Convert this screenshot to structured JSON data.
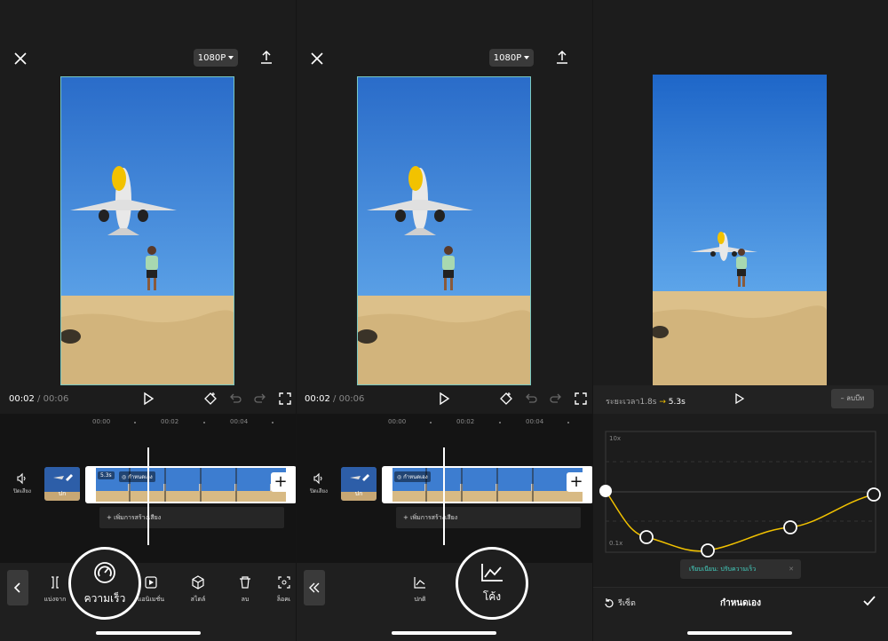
{
  "resolution": "1080P",
  "playback": {
    "current": "00:02",
    "separator": "/",
    "total": "00:06"
  },
  "ruler_labels": [
    "00:00",
    "00:02",
    "00:04"
  ],
  "timeline": {
    "mute_label": "ปิดเสียง",
    "cover_label": "ปก",
    "clip_duration": "5.3s",
    "clip_curve_label": "กำหนดเอง",
    "add_audio_label": "+ เพิ่มการสร้างเสียง"
  },
  "panel1_toolbar": {
    "items": [
      {
        "label": "แบ่งจาก",
        "icon": "split-icon"
      },
      {
        "label": "ความเร็ว",
        "icon": "speed-icon"
      },
      {
        "label": "แอนิเมชั่น",
        "icon": "animation-icon"
      },
      {
        "label": "สไตล์",
        "icon": "cube-icon"
      },
      {
        "label": "ลบ",
        "icon": "trash-icon"
      },
      {
        "label": "ล็อคเ",
        "icon": "focus-icon"
      }
    ],
    "highlight_label": "ความเร็ว"
  },
  "panel2_toolbar": {
    "items": [
      {
        "label": "ปกติ",
        "icon": "chart-icon"
      }
    ],
    "highlight_label": "โค้ง"
  },
  "panel3": {
    "duration_prefix": "ระยะเวลา1.8s",
    "duration_arrow": "→",
    "duration_new": "5.3s",
    "delete_label": "– ลบบีท",
    "axis_top": "10x",
    "axis_bottom": "0.1x",
    "toast": "เรียบเนียน: ปรับความเร็ว",
    "reset_label": "รีเซ็ต",
    "title": "กำหนดเอง"
  },
  "colors": {
    "accent_teal": "#79c7c0",
    "curve": "#f2c200",
    "sky": "#2f74d0",
    "sand": "#dcc08a"
  }
}
